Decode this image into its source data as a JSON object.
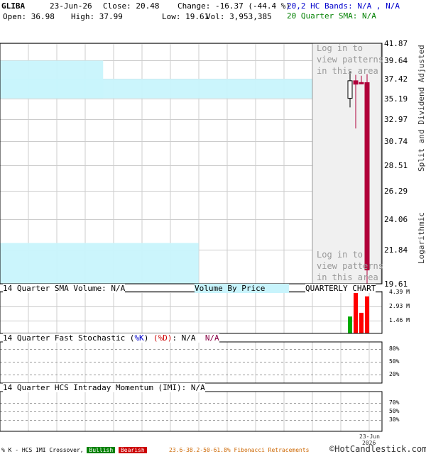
{
  "header": {
    "symbol": "GLIBA",
    "date": "23-Jun-26",
    "close_label": "Close: 20.48",
    "change_label": "Change: -16.37 (-44.4 %)",
    "open_label": "Open: 36.98",
    "high_label": "High: 37.99",
    "low_label": "Low: 19.61",
    "vol_label": "Vol: 3,953,385",
    "bands_label": "20,2 HC Bands: N/A , N/A",
    "sma_label": "20 Quarter SMA: N/A"
  },
  "colors": {
    "bands": "#0000cc",
    "sma": "#008000",
    "bear_candle": "#b0003a",
    "volume_up": "#00aa00",
    "volume_down": "#ff0000",
    "vbp": "#c8f4fc"
  },
  "watermark": {
    "top": "Log in to view patterns in this area",
    "bottom": "Log in to view patterns in this area"
  },
  "right_labels": {
    "adjusted": "Split and Dividend Adjusted",
    "scale": "Logarithmic"
  },
  "panels": {
    "volume_title": "14 Quarter SMA Volume: N/A",
    "vbp_title": "Volume By Price",
    "chart_type": "QUARTERLY CHART",
    "stoch_prefix": "14 Quarter Fast Stochastic (",
    "stoch_k": "%K",
    "stoch_d": "%D",
    "stoch_value": ": N/A",
    "stoch_na": "N/A",
    "imi_title": "14 Quarter HCS Intraday Momentum (IMI): N/A"
  },
  "footer": {
    "crossover": "% K - HCS IMI Crossover,",
    "bullish": "Bullish",
    "bearish": "Bearish",
    "fib": "23.6-38.2-50-61.8% Fibonacci Retracements",
    "brand": "©HotCandlestick.com"
  },
  "chart_data": {
    "type": "candlestick",
    "price_scale": "log",
    "price_ticks": [
      41.87,
      39.64,
      37.42,
      35.19,
      32.97,
      30.74,
      28.51,
      26.29,
      24.06,
      21.84,
      19.61
    ],
    "ylim": [
      19.61,
      41.87
    ],
    "x_tick_labels": [
      "23-Jun",
      "2026"
    ],
    "candles": [
      {
        "open": 35.2,
        "high": 38.3,
        "low": 34.2,
        "close": 37.2,
        "color": "white"
      },
      {
        "open": 37.2,
        "high": 37.9,
        "low": 32.0,
        "close": 36.8,
        "color": "red"
      },
      {
        "open": 37.0,
        "high": 37.8,
        "low": 36.8,
        "close": 36.9,
        "color": "red"
      },
      {
        "open": 36.98,
        "high": 37.99,
        "low": 19.61,
        "close": 20.48,
        "color": "red"
      }
    ],
    "volume_ticks": [
      "4.39 M",
      "2.93 M",
      "1.46 M"
    ],
    "volume_max_m": 4.39,
    "volume_bars_m": [
      {
        "value": 1.8,
        "color": "green"
      },
      {
        "value": 4.39,
        "color": "red"
      },
      {
        "value": 2.2,
        "color": "red"
      },
      {
        "value": 3.95,
        "color": "red"
      }
    ],
    "volume_by_price": [
      {
        "low": 35.19,
        "high": 39.64,
        "relative": 0.27
      },
      {
        "low": 35.19,
        "high": 37.42,
        "relative": 1.0
      },
      {
        "low": 19.61,
        "high": 22.3,
        "relative": 0.52
      }
    ],
    "stochastic_levels": [
      "80%",
      "50%",
      "20%"
    ],
    "imi_levels": [
      "70%",
      "50%",
      "30%"
    ]
  }
}
